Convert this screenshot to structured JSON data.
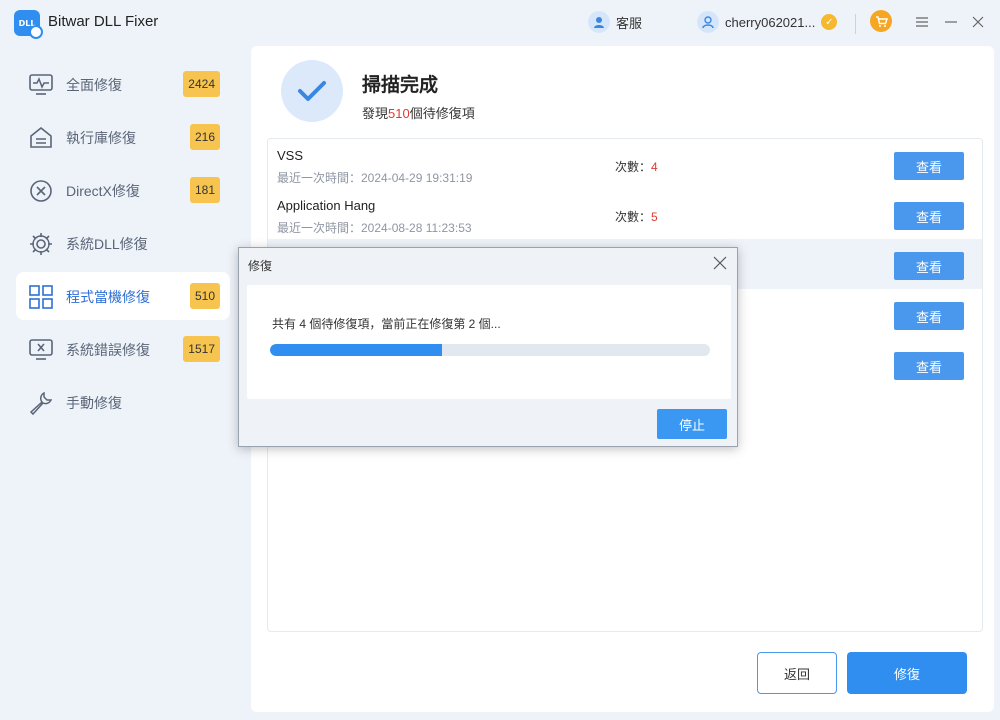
{
  "app": {
    "title": "Bitwar DLL Fixer",
    "logo_text": "DLL"
  },
  "header": {
    "support_label": "客服",
    "username": "cherry062021..."
  },
  "sidebar": {
    "items": [
      {
        "label": "全面修復",
        "badge": "2424",
        "icon": "monitor-pulse-icon"
      },
      {
        "label": "執行庫修復",
        "badge": "216",
        "icon": "library-icon"
      },
      {
        "label": "DirectX修復",
        "badge": "181",
        "icon": "directx-icon"
      },
      {
        "label": "系統DLL修復",
        "badge": "",
        "icon": "gear-icon"
      },
      {
        "label": "程式當機修復",
        "badge": "510",
        "icon": "grid-icon",
        "active": true
      },
      {
        "label": "系統錯誤修復",
        "badge": "1517",
        "icon": "monitor-error-icon"
      },
      {
        "label": "手動修復",
        "badge": "",
        "icon": "wrench-icon"
      }
    ]
  },
  "scan": {
    "title": "掃描完成",
    "sub_prefix": "發現",
    "count": "510",
    "sub_suffix": "個待修復項"
  },
  "results": [
    {
      "name": "VSS",
      "time": "最近一次時間：2024-04-29 19:31:19",
      "count_label": "次數：",
      "count": "4",
      "button": "查看"
    },
    {
      "name": "Application Hang",
      "time": "最近一次時間：2024-08-28 11:23:53",
      "count_label": "次數：",
      "count": "5",
      "button": "查看"
    },
    {
      "name": "",
      "time": "",
      "count_label": "",
      "count": "",
      "button": "查看"
    },
    {
      "name": "",
      "time": "",
      "count_label": "",
      "count": "",
      "button": "查看"
    },
    {
      "name": "",
      "time": "",
      "count_label": "",
      "count": "",
      "button": "查看"
    }
  ],
  "footer": {
    "back_label": "返回",
    "repair_label": "修復"
  },
  "modal": {
    "title": "修復",
    "message": "共有 4 個待修復項，當前正在修復第 2 個...",
    "progress_percent": 39,
    "stop_label": "停止"
  },
  "colors": {
    "accent": "#2f8ef0",
    "badge": "#f7c54f",
    "danger": "#e03a2f"
  }
}
